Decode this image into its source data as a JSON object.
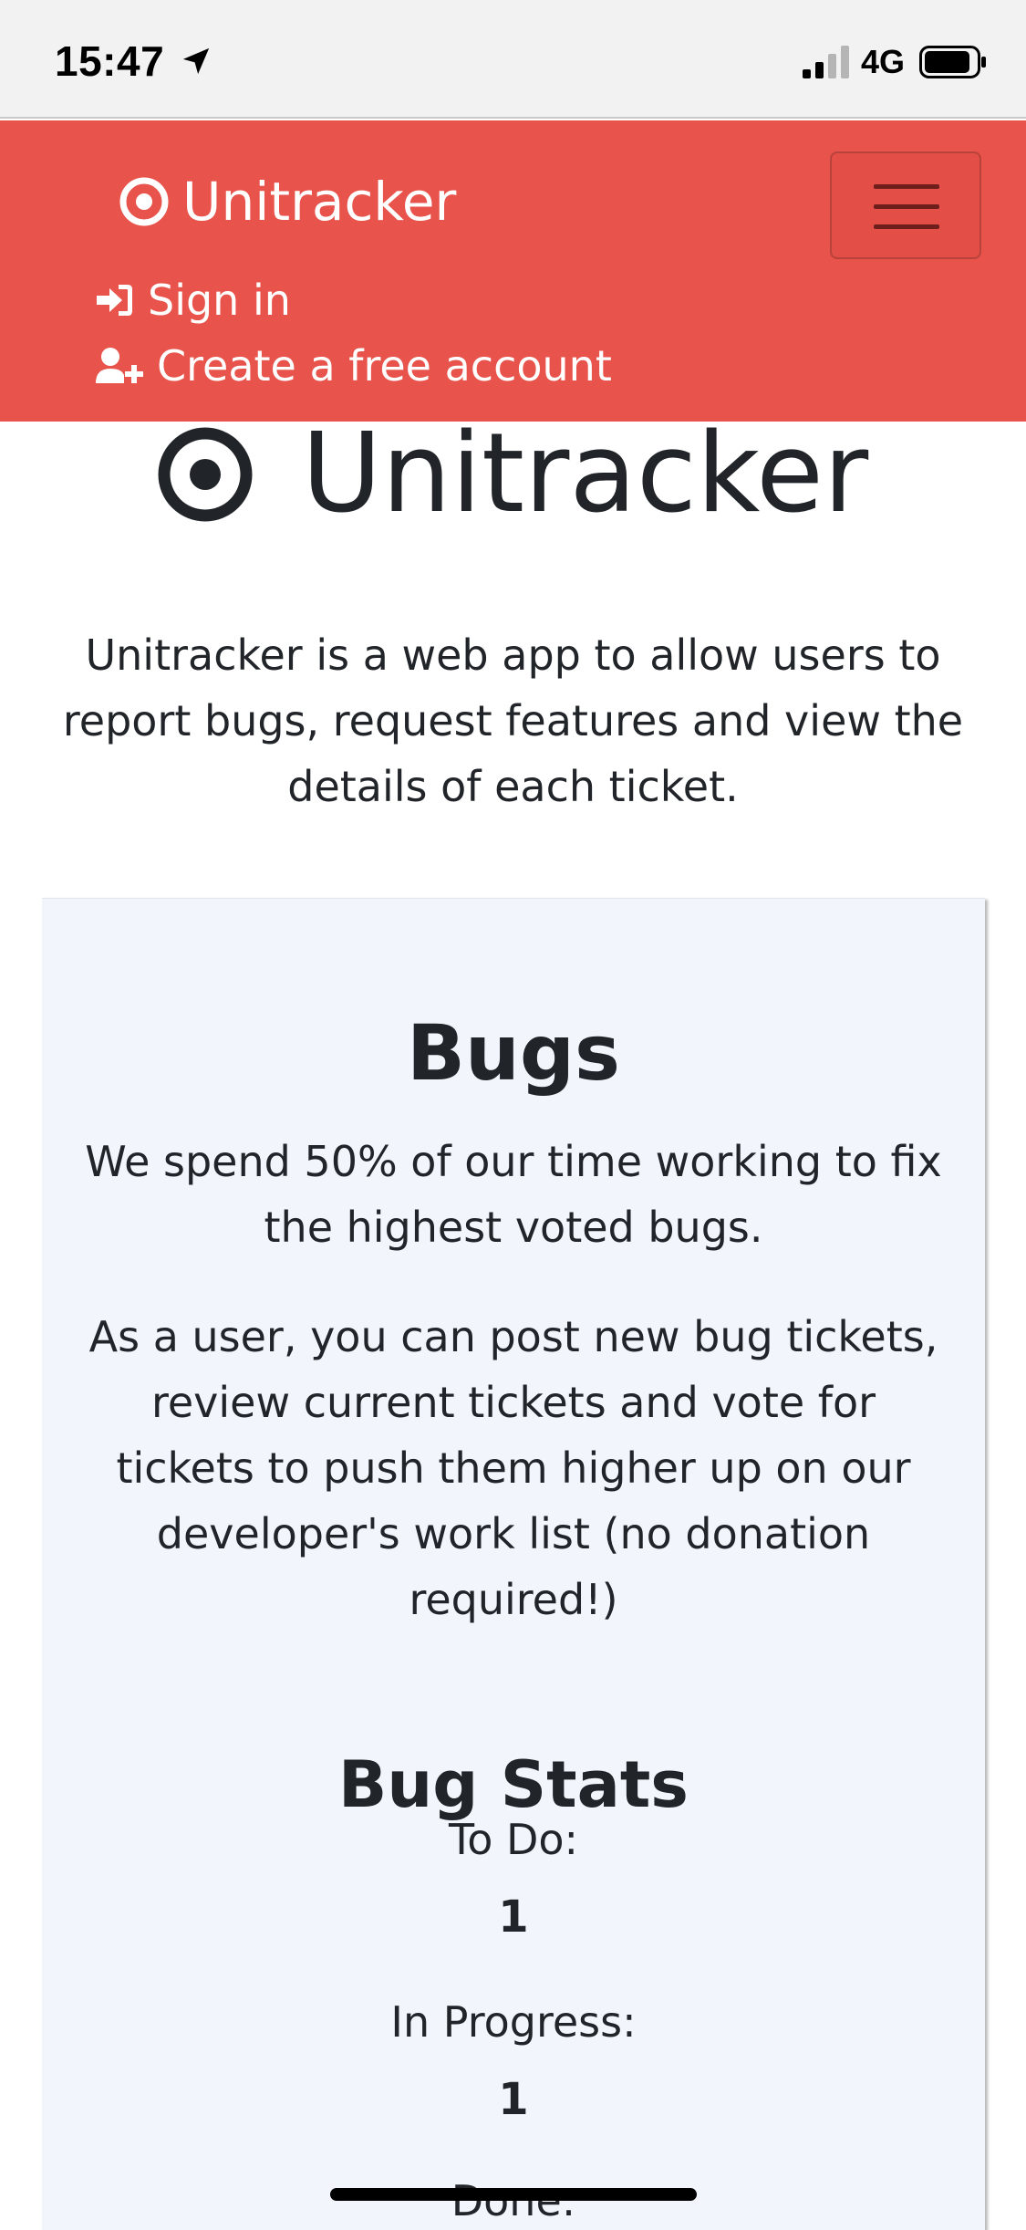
{
  "status_bar": {
    "time": "15:47",
    "network": "4G",
    "icons": [
      "location-arrow-icon",
      "signal-bars-icon",
      "battery-icon"
    ]
  },
  "navbar": {
    "brand": "Unitracker",
    "brand_icon": "bullseye-icon",
    "background_color": "#e8534c",
    "toggler_icon": "hamburger-menu-icon",
    "links": [
      {
        "label": "Sign in",
        "icon": "sign-in-icon"
      },
      {
        "label": "Create a free account",
        "icon": "user-plus-icon"
      }
    ]
  },
  "hero": {
    "title": "Unitracker",
    "icon": "bullseye-icon",
    "intro": "Unitracker is a web app to allow users to report bugs, request features and view the details of each ticket."
  },
  "bugs_card": {
    "title": "Bugs",
    "background_color": "#f2f6fc",
    "paragraph_1": "We spend 50% of our time working to fix the highest voted bugs.",
    "paragraph_2": "As a user, you can post new bug tickets, review current tickets and vote for tickets to push them higher up on our developer's work list (no donation required!)",
    "stats_title": "Bug Stats",
    "stats": [
      {
        "label": "To Do:",
        "value": "1"
      },
      {
        "label": "In Progress:",
        "value": "1"
      },
      {
        "label": "Done:",
        "value": ""
      }
    ]
  }
}
